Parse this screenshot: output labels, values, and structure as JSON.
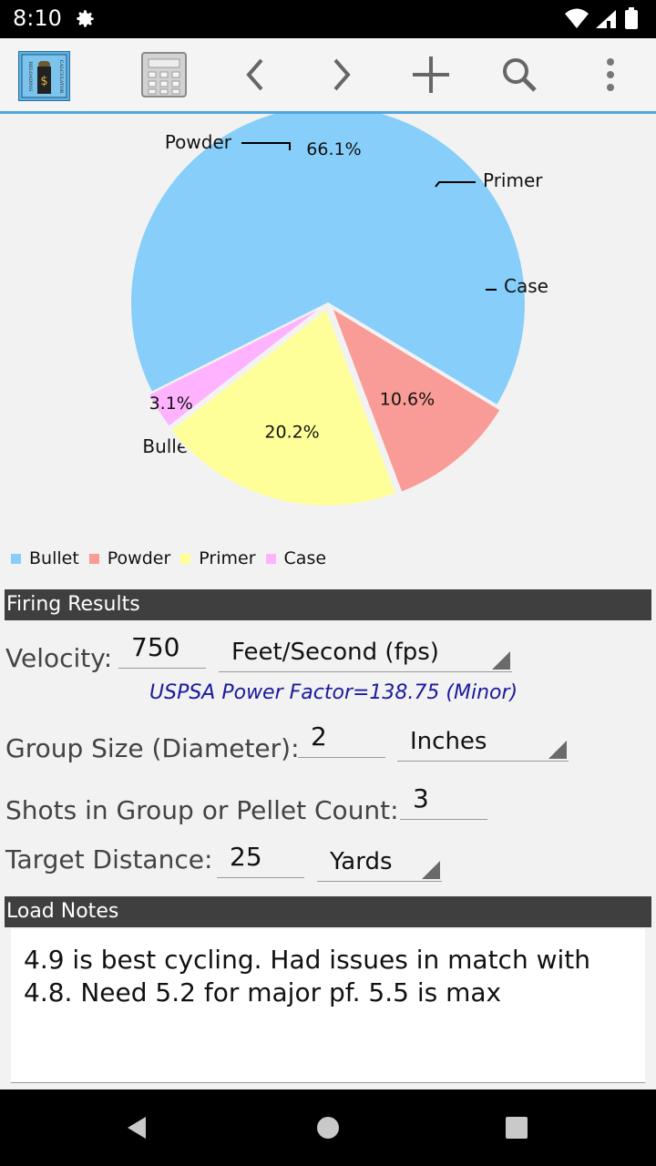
{
  "status_bar": {
    "time": "8:10"
  },
  "app_logo": {
    "text_left": "RELOADING",
    "text_right": "CALCULATOR",
    "symbol": "$"
  },
  "chart_data": {
    "type": "pie",
    "slices": [
      {
        "label": "Bullet",
        "value": 66.1,
        "display": "66.1%",
        "color": "#87cefa"
      },
      {
        "label": "Powder",
        "value": 10.6,
        "display": "10.6%",
        "color": "#f99b97"
      },
      {
        "label": "Primer",
        "value": 20.2,
        "display": "20.2%",
        "color": "#ffff99"
      },
      {
        "label": "Case",
        "value": 3.1,
        "display": "3.1%",
        "color": "#ffb3ff"
      }
    ],
    "legend": [
      "Bullet",
      "Powder",
      "Primer",
      "Case"
    ],
    "legend_position": "bottom-left"
  },
  "firing_results": {
    "title": "Firing Results",
    "velocity": {
      "label": "Velocity:",
      "value": "750",
      "unit": "Feet/Second (fps)"
    },
    "power_factor": "USPSA Power Factor=138.75 (Minor)",
    "group_size": {
      "label": "Group Size (Diameter):",
      "value": "2",
      "unit": "Inches"
    },
    "shots": {
      "label": "Shots in Group or Pellet Count:",
      "value": "3"
    },
    "distance": {
      "label": "Target Distance:",
      "value": "25",
      "unit": "Yards"
    }
  },
  "load_notes": {
    "title": "Load Notes",
    "text": "4.9 is best cycling. Had issues in match with 4.8. Need 5.2 for major pf. 5.5 is max"
  },
  "colors": {
    "accent": "#4da6dc",
    "section_bar": "#3f3f3f",
    "power_factor": "#1a1a9c"
  }
}
